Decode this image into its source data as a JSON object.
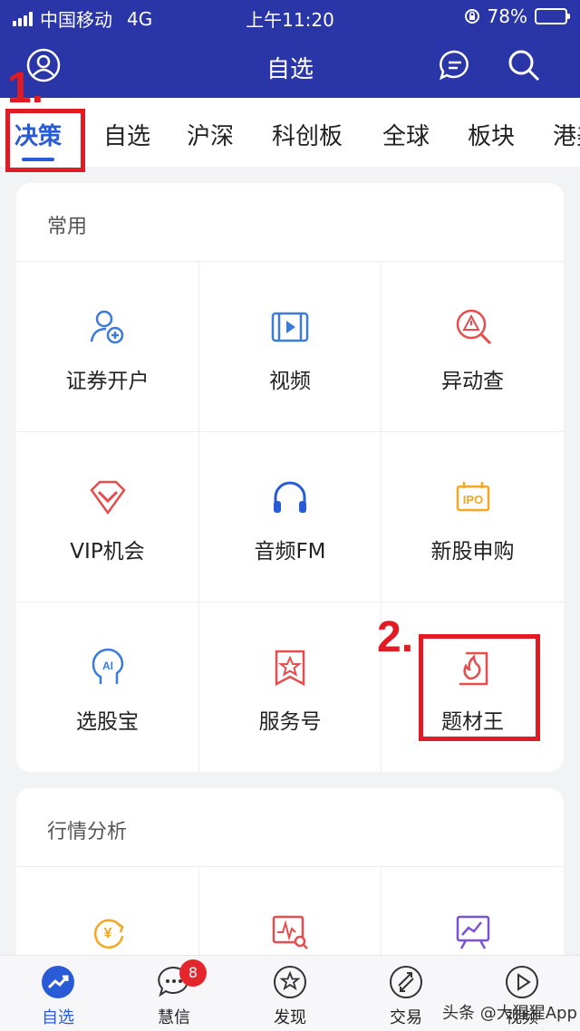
{
  "status_bar": {
    "carrier": "中国移动",
    "network": "4G",
    "time": "上午11:20",
    "battery": "78%"
  },
  "header": {
    "title": "自选"
  },
  "tabs": [
    {
      "label": "决策"
    },
    {
      "label": "自选"
    },
    {
      "label": "沪深"
    },
    {
      "label": "科创板"
    },
    {
      "label": "全球"
    },
    {
      "label": "板块"
    },
    {
      "label": "港美"
    }
  ],
  "sections": [
    {
      "title": "常用",
      "items": [
        {
          "label": "证券开户",
          "icon": "user-add-icon"
        },
        {
          "label": "视频",
          "icon": "video-icon"
        },
        {
          "label": "异动查",
          "icon": "alert-search-icon"
        },
        {
          "label": "VIP机会",
          "icon": "diamond-icon"
        },
        {
          "label": "音频FM",
          "icon": "headphones-icon"
        },
        {
          "label": "新股申购",
          "icon": "ipo-icon"
        },
        {
          "label": "选股宝",
          "icon": "ai-head-icon"
        },
        {
          "label": "服务号",
          "icon": "star-badge-icon"
        },
        {
          "label": "题材王",
          "icon": "flame-doc-icon"
        }
      ]
    },
    {
      "title": "行情分析"
    }
  ],
  "bottom_nav": [
    {
      "label": "自选",
      "icon": "chart-up-icon"
    },
    {
      "label": "慧信",
      "icon": "chat-bubble-icon",
      "badge": "8"
    },
    {
      "label": "发现",
      "icon": "star-circle-icon"
    },
    {
      "label": "交易",
      "icon": "exchange-icon"
    },
    {
      "label": "视频",
      "icon": "play-circle-icon"
    }
  ],
  "annotations": {
    "step1": "1.",
    "step2": "2."
  },
  "watermark": "头条 @大猩猩App",
  "colors": {
    "header_bg": "#2a36a8",
    "accent": "#2a5bd7",
    "icon_red": "#e84c4c",
    "icon_blue": "#3a7bdc",
    "icon_gold": "#f5a623",
    "icon_purple": "#7a52d6",
    "annotation": "#e01b23"
  }
}
